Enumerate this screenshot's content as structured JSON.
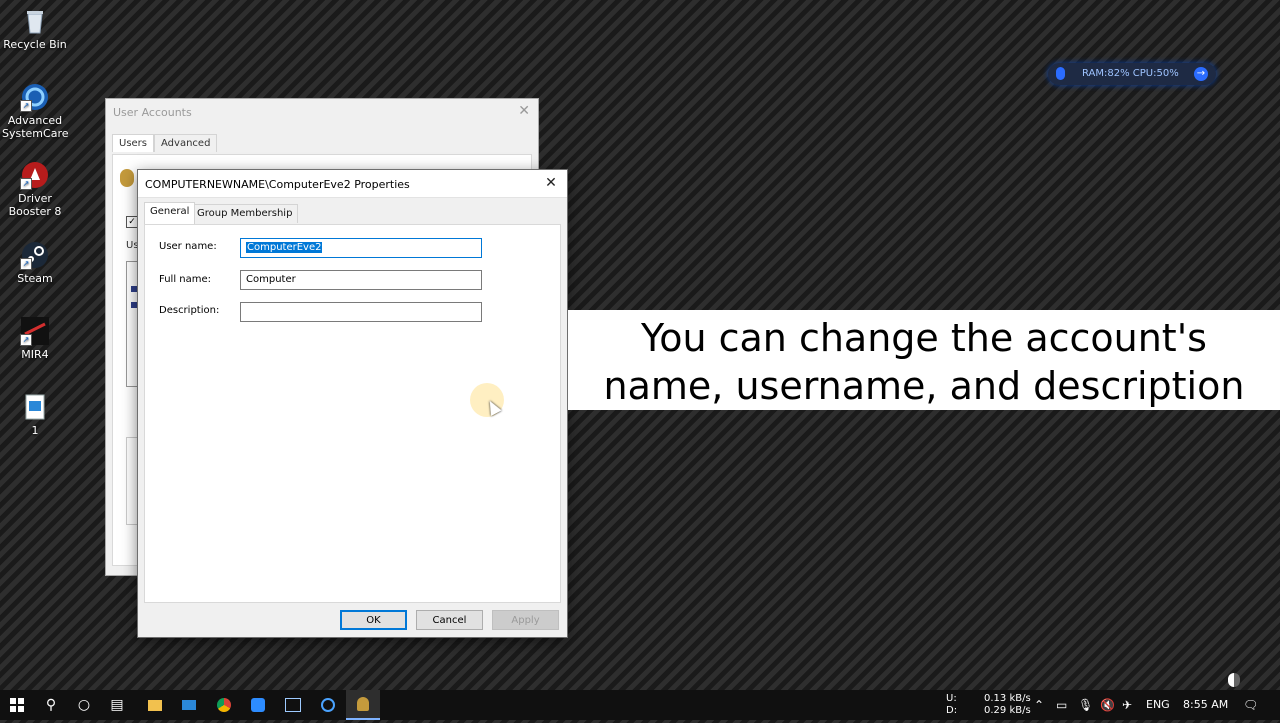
{
  "desktop": {
    "icons": [
      {
        "label": "Recycle Bin",
        "icon": "recycle-bin-icon"
      },
      {
        "label": "Advanced SystemCare",
        "icon": "advanced-systemcare-icon"
      },
      {
        "label": "Driver Booster 8",
        "icon": "driver-booster-icon"
      },
      {
        "label": "Steam",
        "icon": "steam-icon"
      },
      {
        "label": "MIR4",
        "icon": "mir4-icon"
      },
      {
        "label": "1",
        "icon": "file-icon"
      }
    ]
  },
  "widget": {
    "text": "RAM:82%  CPU:50%",
    "go": "→"
  },
  "user_accounts": {
    "title": "User Accounts",
    "tabs": [
      "Users",
      "Advanced"
    ],
    "fragment": "Us"
  },
  "dialog": {
    "title": "COMPUTERNEWNAME\\ComputerEve2 Properties",
    "close": "✕",
    "tabs": [
      "General",
      "Group Membership"
    ],
    "fields": {
      "username": {
        "label": "User name:",
        "value": "ComputerEve2"
      },
      "fullname": {
        "label": "Full name:",
        "value": "Computer"
      },
      "description": {
        "label": "Description:",
        "value": ""
      }
    },
    "buttons": {
      "ok": "OK",
      "cancel": "Cancel",
      "apply": "Apply"
    }
  },
  "caption": {
    "line1": "You can change the account's",
    "line2": "name, username, and description"
  },
  "taskbar": {
    "net_up_label": "U:",
    "net_down_label": "D:",
    "net_up": "0.13 kB/s",
    "net_down": "0.29 kB/s",
    "language": "ENG",
    "time": "8:55 AM"
  },
  "colors": {
    "accent": "#0078d7",
    "taskbar": "#101010"
  }
}
